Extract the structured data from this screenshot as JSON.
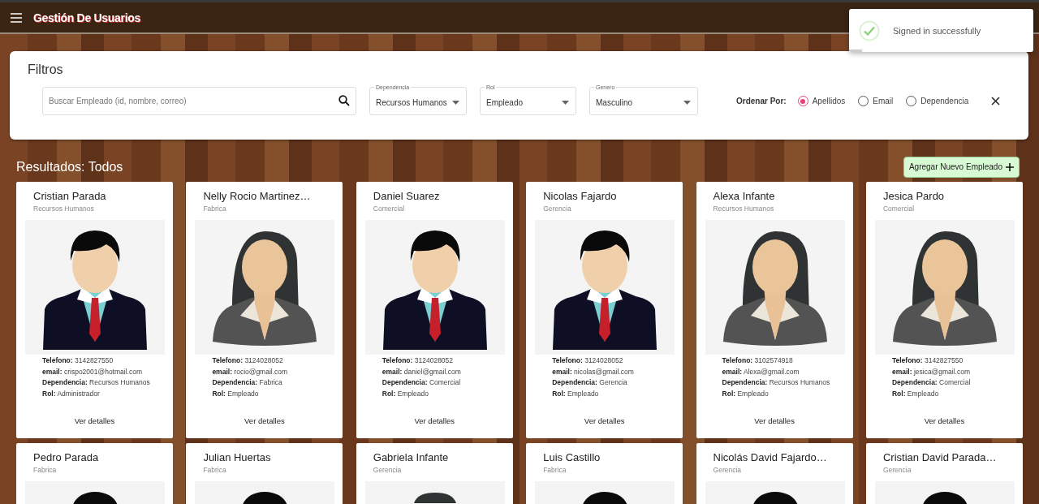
{
  "app_bar": {
    "title": "Gestión De Usuarios"
  },
  "toast": {
    "message": "Signed in successfully",
    "level": 0.07
  },
  "filters": {
    "title": "Filtros",
    "search": {
      "placeholder": "Buscar Empleado (id, nombre, correo)"
    },
    "selects": [
      {
        "label": "Dependencia",
        "value": "Recursos Humanos"
      },
      {
        "label": "Rol",
        "value": "Empleado"
      },
      {
        "label": "Genero",
        "value": "Masculino"
      }
    ],
    "sort_label": "Ordenar Por:",
    "sort_options": [
      {
        "label": "Apellidos",
        "selected": true
      },
      {
        "label": "Email",
        "selected": false
      },
      {
        "label": "Dependencia",
        "selected": false
      }
    ]
  },
  "results": {
    "title": "Resultados: Todos",
    "add_button": "Agregar Nuevo Empleado"
  },
  "employees": [
    {
      "name": "Cristian Parada",
      "department": "Recursos Humanos",
      "kind": "male",
      "details": [
        "**Telefono:** 3142827550",
        "**email:** crispo2001@hotmail.com",
        "**Dependencia:** Recursos Humanos",
        "**Rol:** Administrador"
      ],
      "action": "Ver detalles"
    },
    {
      "name": "Nelly Rocio Martinez…",
      "department": "Fabrica",
      "kind": "female",
      "details": [
        "**Telefono:** 3124028052",
        "**email:** rocio@gmail.com",
        "**Dependencia:** Fabrica",
        "**Rol:** Empleado"
      ],
      "action": "Ver detalles"
    },
    {
      "name": "Daniel Suarez",
      "department": "Comercial",
      "kind": "male",
      "details": [
        "**Telefono:** 3124028052",
        "**email:** daniel@gmail.com",
        "**Dependencia:** Comercial",
        "**Rol:** Empleado"
      ],
      "action": "Ver detalles"
    },
    {
      "name": "Nicolas Fajardo",
      "department": "Gerencia",
      "kind": "male",
      "details": [
        "**Telefono:** 3124028052",
        "**email:** nicolas@gmail.com",
        "**Dependencia:** Gerencia",
        "**Rol:** Empleado"
      ],
      "action": "Ver detalles"
    },
    {
      "name": "Alexa Infante",
      "department": "Recursos Humanos",
      "kind": "female",
      "details": [
        "**Telefono:** 3102574918",
        "**email:** Alexa@gmail.com",
        "**Dependencia:** Recursos Humanos",
        "**Rol:** Empleado"
      ],
      "action": "Ver detalles"
    },
    {
      "name": "Jesica Pardo",
      "department": "Comercial",
      "kind": "female",
      "details": [
        "**Telefono:** 3142827550",
        "**email:** jesica@gmail.com",
        "**Dependencia:** Comercial",
        "**Rol:** Empleado"
      ],
      "action": "Ver detalles"
    },
    {
      "name": "Pedro Parada",
      "department": "Fabrica",
      "kind": "male"
    },
    {
      "name": "Julian Huertas",
      "department": "Fabrica",
      "kind": "male"
    },
    {
      "name": "Gabriela Infante",
      "department": "Gerencia",
      "kind": "female"
    },
    {
      "name": "Luis Castillo",
      "department": "Fabrica",
      "kind": "male"
    },
    {
      "name": "Nicolás David Fajardo…",
      "department": "Gerencia",
      "kind": "male"
    },
    {
      "name": "Cristian David Parada…",
      "department": "Gerencia",
      "kind": "male"
    }
  ]
}
